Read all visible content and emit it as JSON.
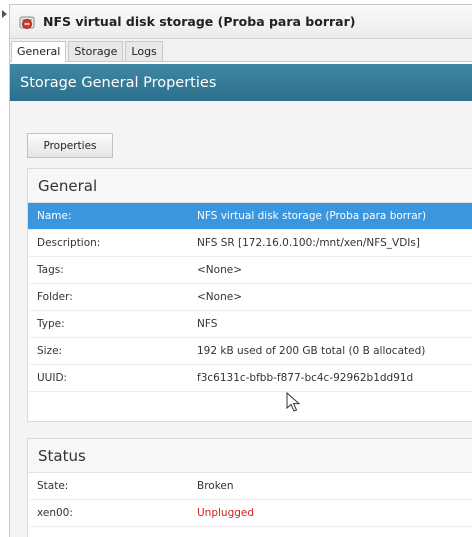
{
  "window": {
    "title": "NFS virtual disk storage (Proba para borrar)",
    "icon": "storage-error-icon"
  },
  "tabs": [
    {
      "label": "General",
      "active": true
    },
    {
      "label": "Storage",
      "active": false
    },
    {
      "label": "Logs",
      "active": false
    }
  ],
  "header": {
    "title": "Storage General Properties"
  },
  "toolbar": {
    "properties_label": "Properties"
  },
  "general": {
    "title": "General",
    "rows": [
      {
        "label": "Name:",
        "value": "NFS virtual disk storage (Proba para borrar)"
      },
      {
        "label": "Description:",
        "value": "NFS SR [172.16.0.100:/mnt/xen/NFS_VDIs]"
      },
      {
        "label": "Tags:",
        "value": "<None>"
      },
      {
        "label": "Folder:",
        "value": "<None>"
      },
      {
        "label": "Type:",
        "value": "NFS"
      },
      {
        "label": "Size:",
        "value": "192 kB used of 200 GB total (0 B allocated)"
      },
      {
        "label": "UUID:",
        "value": "f3c6131c-bfbb-f877-bc4c-92962b1dd91d"
      }
    ]
  },
  "status": {
    "title": "Status",
    "rows": [
      {
        "label": "State:",
        "value": "Broken"
      },
      {
        "label": "xen00:",
        "value": "Unplugged"
      }
    ]
  },
  "colors": {
    "header_band": "#2c6f8c",
    "selection": "#3a96de",
    "error_text": "#d42020"
  }
}
